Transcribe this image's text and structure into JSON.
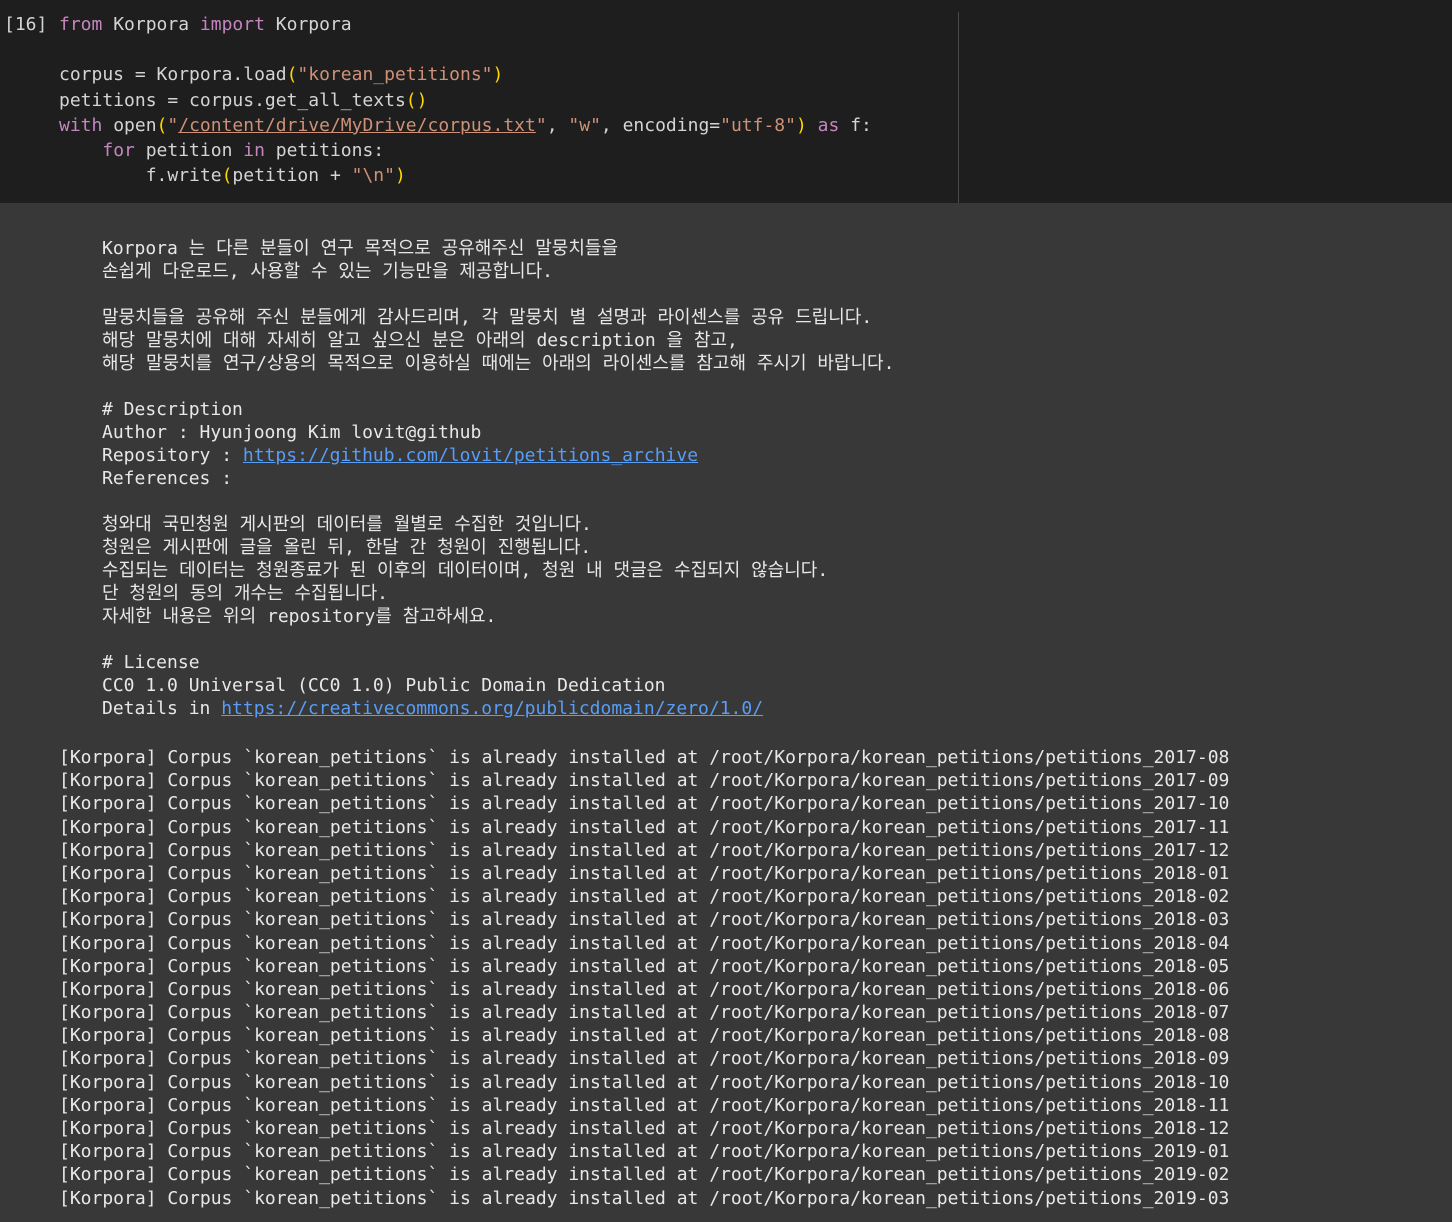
{
  "cell": {
    "execution_count": "[16]",
    "code": {
      "line1": {
        "kw1": "from",
        "mod": " Korpora ",
        "kw2": "import",
        "name": " Korpora"
      },
      "line2": "",
      "line3": {
        "pre": "corpus = Korpora.load",
        "open": "(",
        "arg": "\"korean_petitions\"",
        "close": ")"
      },
      "line4": {
        "pre": "petitions = corpus.get_all_texts",
        "parens": "()"
      },
      "line5": {
        "kw": "with",
        "fn": " open",
        "open": "(",
        "q1": "\"",
        "path": "/content/drive/MyDrive/corpus.txt",
        "q2": "\"",
        "sep1": ", ",
        "mode": "\"w\"",
        "sep2": ", encoding=",
        "enc": "\"utf-8\"",
        "close": ")",
        "as": "as",
        "var": " f:"
      },
      "line6": {
        "indent": "    ",
        "kw1": "for",
        "mid": " petition ",
        "kw2": "in",
        "rest": " petitions:"
      },
      "line7": {
        "pre": "        f.write",
        "open": "(",
        "mid": "petition + ",
        "str": "\"\\n\"",
        "close": ")"
      }
    }
  },
  "output": {
    "info": {
      "intro1": "Korpora 는 다른 분들이 연구 목적으로 공유해주신 말뭉치들을",
      "intro2": "손쉽게 다운로드, 사용할 수 있는 기능만을 제공합니다.",
      "thanks1": "말뭉치들을 공유해 주신 분들에게 감사드리며, 각 말뭉치 별 설명과 라이센스를 공유 드립니다.",
      "thanks2": "해당 말뭉치에 대해 자세히 알고 싶으신 분은 아래의 description 을 참고,",
      "thanks3": "해당 말뭉치를 연구/상용의 목적으로 이용하실 때에는 아래의 라이센스를 참고해 주시기 바랍니다.",
      "desc_header": "# Description",
      "author": "Author : Hyunjoong Kim lovit@github",
      "repo_label": "Repository : ",
      "repo_url": "https://github.com/lovit/petitions_archive",
      "references": "References :",
      "body1": "청와대 국민청원 게시판의 데이터를 월별로 수집한 것입니다.",
      "body2": "청원은 게시판에 글을 올린 뒤, 한달 간 청원이 진행됩니다.",
      "body3": "수집되는 데이터는 청원종료가 된 이후의 데이터이며, 청원 내 댓글은 수집되지 않습니다.",
      "body4": "단 청원의 동의 개수는 수집됩니다.",
      "body5": "자세한 내용은 위의 repository를 참고하세요.",
      "license_header": "# License",
      "license_name": "CC0 1.0 Universal (CC0 1.0) Public Domain Dedication",
      "details_label": "Details in ",
      "details_url": "https://creativecommons.org/publicdomain/zero/1.0/"
    },
    "logs": [
      "[Korpora] Corpus `korean_petitions` is already installed at /root/Korpora/korean_petitions/petitions_2017-08",
      "[Korpora] Corpus `korean_petitions` is already installed at /root/Korpora/korean_petitions/petitions_2017-09",
      "[Korpora] Corpus `korean_petitions` is already installed at /root/Korpora/korean_petitions/petitions_2017-10",
      "[Korpora] Corpus `korean_petitions` is already installed at /root/Korpora/korean_petitions/petitions_2017-11",
      "[Korpora] Corpus `korean_petitions` is already installed at /root/Korpora/korean_petitions/petitions_2017-12",
      "[Korpora] Corpus `korean_petitions` is already installed at /root/Korpora/korean_petitions/petitions_2018-01",
      "[Korpora] Corpus `korean_petitions` is already installed at /root/Korpora/korean_petitions/petitions_2018-02",
      "[Korpora] Corpus `korean_petitions` is already installed at /root/Korpora/korean_petitions/petitions_2018-03",
      "[Korpora] Corpus `korean_petitions` is already installed at /root/Korpora/korean_petitions/petitions_2018-04",
      "[Korpora] Corpus `korean_petitions` is already installed at /root/Korpora/korean_petitions/petitions_2018-05",
      "[Korpora] Corpus `korean_petitions` is already installed at /root/Korpora/korean_petitions/petitions_2018-06",
      "[Korpora] Corpus `korean_petitions` is already installed at /root/Korpora/korean_petitions/petitions_2018-07",
      "[Korpora] Corpus `korean_petitions` is already installed at /root/Korpora/korean_petitions/petitions_2018-08",
      "[Korpora] Corpus `korean_petitions` is already installed at /root/Korpora/korean_petitions/petitions_2018-09",
      "[Korpora] Corpus `korean_petitions` is already installed at /root/Korpora/korean_petitions/petitions_2018-10",
      "[Korpora] Corpus `korean_petitions` is already installed at /root/Korpora/korean_petitions/petitions_2018-11",
      "[Korpora] Corpus `korean_petitions` is already installed at /root/Korpora/korean_petitions/petitions_2018-12",
      "[Korpora] Corpus `korean_petitions` is already installed at /root/Korpora/korean_petitions/petitions_2019-01",
      "[Korpora] Corpus `korean_petitions` is already installed at /root/Korpora/korean_petitions/petitions_2019-02",
      "[Korpora] Corpus `korean_petitions` is already installed at /root/Korpora/korean_petitions/petitions_2019-03"
    ]
  },
  "colors": {
    "code_background": "#1e1e1e",
    "output_background": "#383838",
    "keyword": "#c586c0",
    "string": "#ce9178",
    "bracket": "#ffd700",
    "link": "#589df6"
  }
}
